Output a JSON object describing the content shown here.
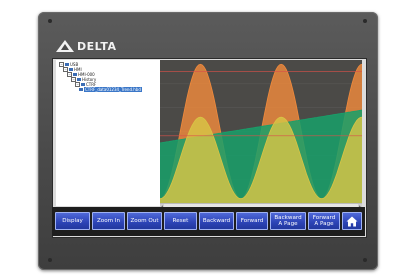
{
  "brand": {
    "name": "DELTA"
  },
  "tree": {
    "items": [
      {
        "label": "USB",
        "level": 0
      },
      {
        "label": "HMI",
        "level": 1
      },
      {
        "label": "HMI-000",
        "level": 2
      },
      {
        "label": "History",
        "level": 3
      },
      {
        "label": "CTRF",
        "level": 4
      },
      {
        "label": "CTRF_data01234_Trend.hbd",
        "level": 5,
        "selected": true
      }
    ]
  },
  "chart_data": {
    "type": "area",
    "title": "",
    "xlabel": "",
    "ylabel": "",
    "grid": true,
    "series": [
      {
        "color": "#f08a3c",
        "shape": "sine",
        "periods": 2.5,
        "min": 0.03,
        "max": 0.97
      },
      {
        "color": "#d8c445",
        "shape": "sine",
        "periods": 2.5,
        "min": 0.03,
        "max": 0.6
      },
      {
        "color": "#18a06a",
        "shape": "ramp",
        "start": 0.42,
        "end": 0.65
      }
    ],
    "reference_lines": [
      {
        "value": 0.92,
        "color": "#d9504a"
      },
      {
        "value": 0.47,
        "color": "#d9504a"
      }
    ],
    "ylim": [
      0,
      1
    ]
  },
  "buttons": {
    "display": "Display",
    "zoom_in": "Zoom In",
    "zoom_out": "Zoom Out",
    "reset": "Reset",
    "backward": "Backward",
    "forward": "Forward",
    "backward_page_1": "Backward",
    "backward_page_2": "A Page",
    "forward_page_1": "Forward",
    "forward_page_2": "A Page",
    "home_icon": "home-icon"
  },
  "colors": {
    "button_blue": "#2c43b5",
    "bezel": "#4a4a4a",
    "accent_orange": "#f08a3c",
    "accent_green": "#18a06a"
  }
}
